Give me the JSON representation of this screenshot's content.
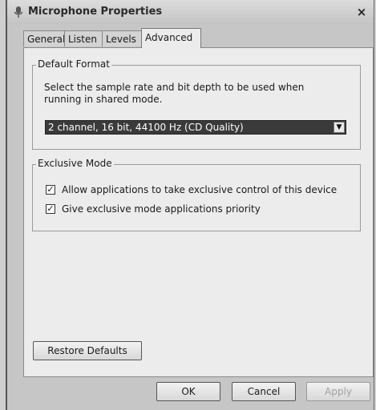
{
  "window": {
    "title": "Microphone Properties",
    "close_glyph": "×"
  },
  "tabs": [
    {
      "label": "General"
    },
    {
      "label": "Listen"
    },
    {
      "label": "Levels"
    },
    {
      "label": "Advanced",
      "active": true
    }
  ],
  "default_format": {
    "group_label": "Default Format",
    "description": "Select the sample rate and bit depth to be used when running in shared mode.",
    "selected_value": "2 channel, 16 bit, 44100 Hz (CD Quality)",
    "dropdown_glyph": "▼"
  },
  "exclusive_mode": {
    "group_label": "Exclusive Mode",
    "options": [
      {
        "label": "Allow applications to take exclusive control of this device",
        "checked": true,
        "mark": "✓"
      },
      {
        "label": "Give exclusive mode applications priority",
        "checked": true,
        "mark": "✓"
      }
    ]
  },
  "buttons": {
    "restore_defaults": "Restore Defaults",
    "ok": "OK",
    "cancel": "Cancel",
    "apply": "Apply"
  },
  "icons": {
    "app": "microphone-icon",
    "close": "close-icon",
    "dropdown": "chevron-down-icon",
    "check": "checkmark-icon"
  }
}
